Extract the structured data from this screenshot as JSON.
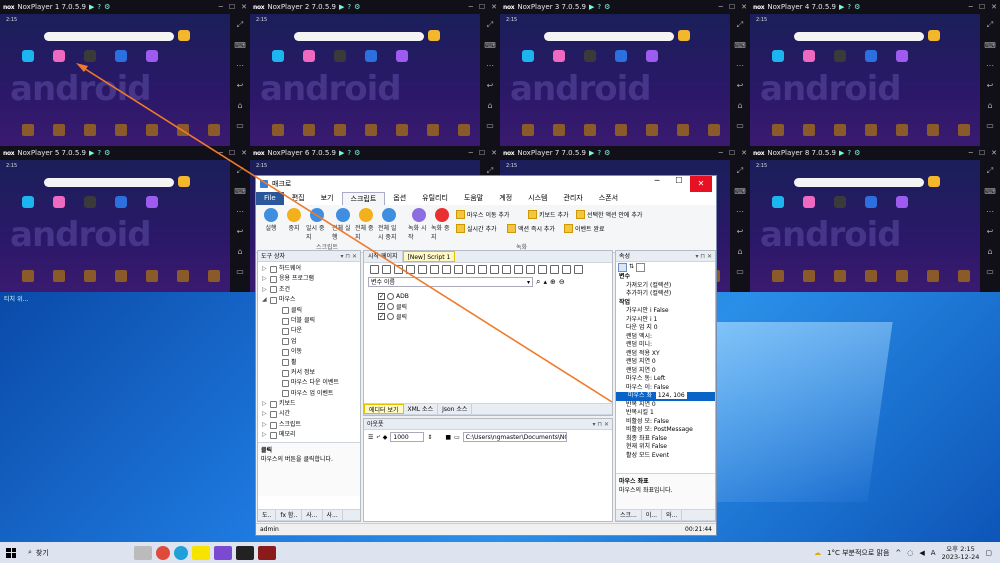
{
  "nox_windows": [
    {
      "title": "NoxPlayer 1 7.0.5.9",
      "time": "2:15"
    },
    {
      "title": "NoxPlayer 2 7.0.5.9",
      "time": "2:15"
    },
    {
      "title": "NoxPlayer 3 7.0.5.9",
      "time": "2:15"
    },
    {
      "title": "NoxPlayer 4 7.0.5.9",
      "time": "2:15"
    },
    {
      "title": "NoxPlayer 5 7.0.5.9",
      "time": "2:15"
    },
    {
      "title": "NoxPlayer 6 7.0.5.9",
      "time": "2:15"
    },
    {
      "title": "NoxPlayer 7 7.0.5.9",
      "time": "2:15"
    },
    {
      "title": "NoxPlayer 8 7.0.5.9",
      "time": "2:15"
    }
  ],
  "nox_logo": "nox",
  "nox_bg_text": "android",
  "desktop_label": "티치 위...",
  "app": {
    "title": "매크로",
    "menu": [
      "File",
      "편집",
      "보기",
      "스크립트",
      "옵션",
      "유틸리티",
      "도움말",
      "계정",
      "시스템",
      "관리자",
      "스폰서"
    ],
    "ribbon": {
      "buttons": [
        {
          "label": "실행",
          "color": "#3f8ee0"
        },
        {
          "label": "중지",
          "color": "#f2b01c"
        },
        {
          "label": "일시 중지",
          "color": "#3f8ee0"
        },
        {
          "label": "전체 실행",
          "color": "#3f8ee0"
        },
        {
          "label": "전체 중지",
          "color": "#f2b01c"
        },
        {
          "label": "전체 일시 중지",
          "color": "#3f8ee0"
        },
        {
          "label": "녹화 시작",
          "color": "#8c6ee0"
        },
        {
          "label": "녹화 중지",
          "color": "#e83030"
        }
      ],
      "small": [
        "마우스 이동 추가",
        "키보드 추가",
        "선택한 액션 안에 추가",
        "실시간 추가",
        "액션 즉시 추가",
        "이벤트 완료"
      ],
      "group_script": "스크립트",
      "group_record": "녹화"
    },
    "toolbox": {
      "header": "도구 상자",
      "items": [
        {
          "label": "하드웨어",
          "level": 0,
          "toggle": "▷"
        },
        {
          "label": "응용 프로그램",
          "level": 0,
          "toggle": "▷"
        },
        {
          "label": "조건",
          "level": 0,
          "toggle": "▷"
        },
        {
          "label": "마우스",
          "level": 0,
          "toggle": "◢"
        },
        {
          "label": "클릭",
          "level": 1,
          "toggle": ""
        },
        {
          "label": "더블 클릭",
          "level": 1,
          "toggle": ""
        },
        {
          "label": "다운",
          "level": 1,
          "toggle": ""
        },
        {
          "label": "업",
          "level": 1,
          "toggle": ""
        },
        {
          "label": "이동",
          "level": 1,
          "toggle": ""
        },
        {
          "label": "휠",
          "level": 1,
          "toggle": ""
        },
        {
          "label": "커서 정보",
          "level": 1,
          "toggle": ""
        },
        {
          "label": "마우스 다운 이벤트",
          "level": 1,
          "toggle": ""
        },
        {
          "label": "마우스 업 이벤트",
          "level": 1,
          "toggle": ""
        },
        {
          "label": "키보드",
          "level": 0,
          "toggle": "▷"
        },
        {
          "label": "시간",
          "level": 0,
          "toggle": "▷"
        },
        {
          "label": "스크립트",
          "level": 0,
          "toggle": "▷"
        },
        {
          "label": "메모리",
          "level": 0,
          "toggle": "▷"
        }
      ],
      "desc_title": "클릭",
      "desc_text": "마우스의 버튼을 클릭합니다.",
      "bottom_tabs": [
        "도..",
        "fx 함..",
        "사...",
        "사..."
      ]
    },
    "editor": {
      "tabs": [
        "시작 페이지",
        "[New] Script 1"
      ],
      "var_placeholder": "변수 이름",
      "lines": [
        {
          "label": "ADB",
          "checked": true
        },
        {
          "label": "클릭",
          "checked": true
        },
        {
          "label": "클릭",
          "checked": true
        }
      ],
      "bottom_tabs": [
        "에디터 보기",
        "XML 소스",
        "Json 소스"
      ]
    },
    "output": {
      "header": "아웃풋",
      "value": "1000",
      "path": "C:\\Users\\ngmaster\\Documents\\NGM"
    },
    "props": {
      "header": "속성",
      "rows": [
        {
          "text": "가져오기 (컬렉션)",
          "cat": false
        },
        {
          "text": "추가하기 (컬렉션)",
          "cat": false
        },
        {
          "text": "작업",
          "cat": true
        },
        {
          "text": "가우시안 i False",
          "cat": false
        },
        {
          "text": "가우시안 i 1",
          "cat": false
        },
        {
          "text": "다운 업 지 0",
          "cat": false
        },
        {
          "text": "랜덤 엑시:",
          "cat": false
        },
        {
          "text": "랜덤 미니:",
          "cat": false
        },
        {
          "text": "랜덤 적용 XY",
          "cat": false
        },
        {
          "text": "랜덤 지연 0",
          "cat": false
        },
        {
          "text": "랜덤 지연 0",
          "cat": false
        },
        {
          "text": "마우스 동: Left",
          "cat": false
        },
        {
          "text": "마우스 이: False",
          "cat": false
        },
        {
          "text": "마우스 좌",
          "value": "124, 106",
          "cat": false,
          "hl": true
        },
        {
          "text": "반복 지연 0",
          "cat": false
        },
        {
          "text": "반복시킬 1",
          "cat": false
        },
        {
          "text": "비활성 모: False",
          "cat": false
        },
        {
          "text": "비활성 모: PostMessage",
          "cat": false
        },
        {
          "text": "최종 좌표 False",
          "cat": false
        },
        {
          "text": "현재 위치 False",
          "cat": false
        },
        {
          "text": "활성 모드 Event",
          "cat": false
        }
      ],
      "cat_var": "변수",
      "desc_title": "마우스 좌표",
      "desc_text": "마우스의 좌표입니다.",
      "bottom_tabs": [
        "스크...",
        "이...",
        "와..."
      ]
    },
    "status": {
      "user": "admin",
      "time": "00:21:44"
    }
  },
  "taskbar": {
    "search": "찾기",
    "weather": "1°C 부분적으로 맑음",
    "ime": "A",
    "time": "오후 2:15",
    "date": "2023-12-24"
  }
}
